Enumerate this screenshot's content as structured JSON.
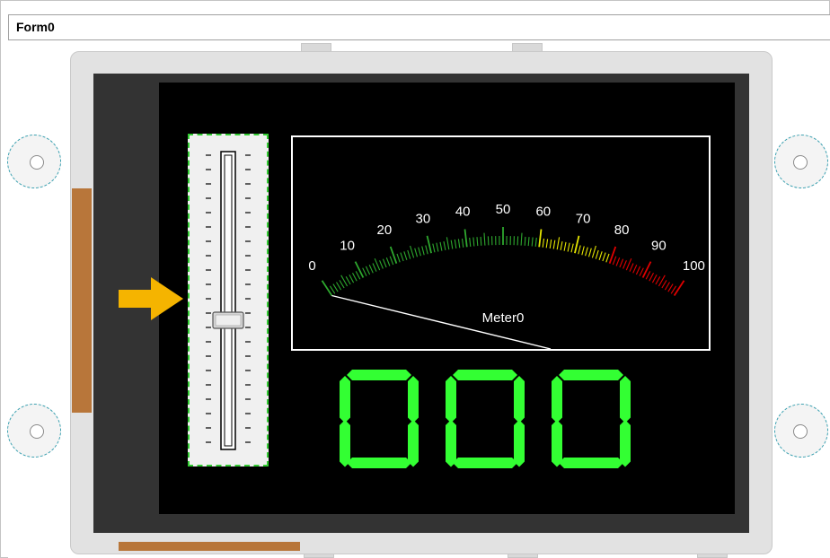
{
  "window": {
    "title": "Form0"
  },
  "meter": {
    "name": "Meter0",
    "min": 0,
    "max": 100,
    "value": 0,
    "tick_labels": [
      "0",
      "10",
      "20",
      "30",
      "40",
      "50",
      "60",
      "70",
      "80",
      "90",
      "100"
    ],
    "zone_colors": {
      "low": "#2ea82e",
      "mid": "#e6e600",
      "high": "#e00000"
    }
  },
  "slider": {
    "value": 50,
    "min": 0,
    "max": 100
  },
  "led_display": {
    "digits": [
      "0",
      "0",
      "0"
    ],
    "color": "#33ff33"
  },
  "pointer": {
    "icon": "arrow-right-icon",
    "color": "#f5b400"
  }
}
